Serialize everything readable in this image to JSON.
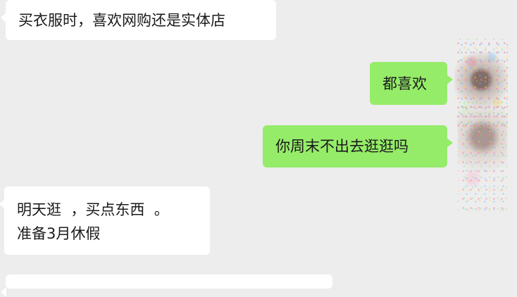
{
  "chat": {
    "messages": [
      {
        "side": "in",
        "text": "买衣服时，喜欢网购还是实体店"
      },
      {
        "side": "out",
        "text": "都喜欢"
      },
      {
        "side": "out",
        "text": "你周末不出去逛逛吗"
      },
      {
        "side": "in",
        "text": "明天逛  ，买点东西  。\n准备3月休假"
      },
      {
        "side": "in",
        "text": ""
      }
    ]
  },
  "colors": {
    "background": "#ededed",
    "incoming_bubble": "#ffffff",
    "outgoing_bubble": "#95ec69",
    "text": "#1b1b1b"
  },
  "icons": {
    "self_avatar": "avatar-icon",
    "contact_avatar": "avatar-icon"
  }
}
